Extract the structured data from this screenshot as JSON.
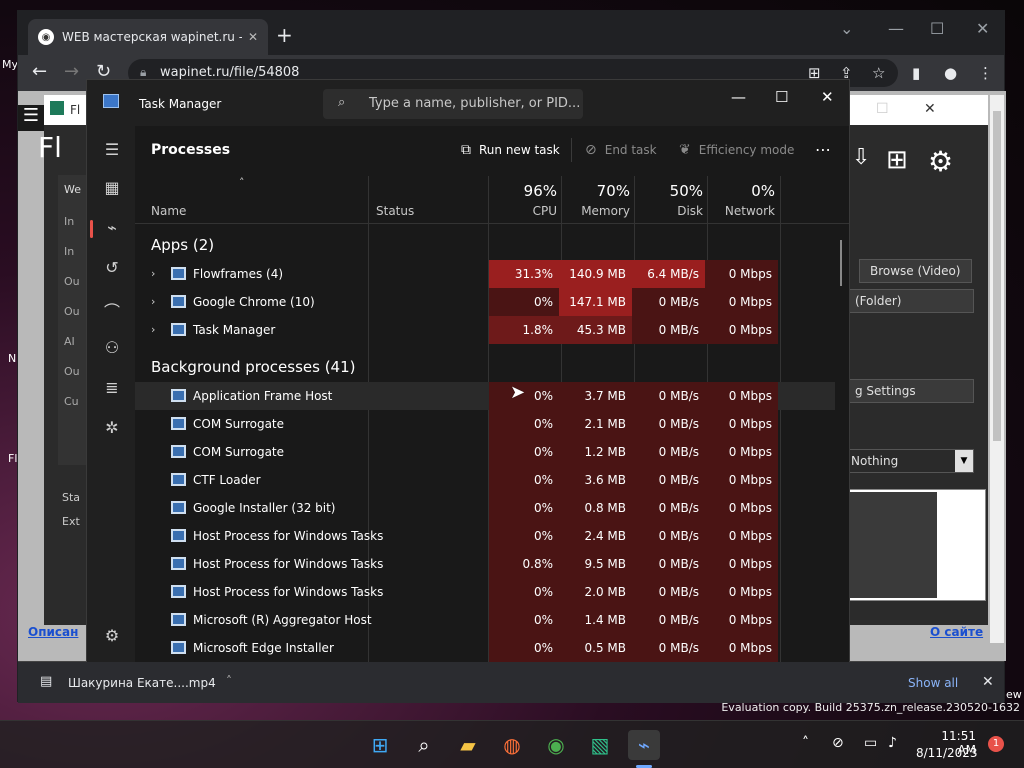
{
  "desktop": {
    "eval_text": "Evaluation copy. Build 25375.zn_release.230520-1632",
    "frag_my": "My",
    "frag_n": "N",
    "frag_fl": "Fl",
    "frag_ew": "ew"
  },
  "chrome": {
    "tab_title": "WEB мастерская wapinet.ru - Ш",
    "url": "wapinet.ru/file/54808",
    "download_file": "Шакурина Екате....mp4",
    "show_all": "Show all",
    "page_links": {
      "left": "Описан",
      "right": "О сайте"
    }
  },
  "flowframes": {
    "title_frag": "Fl",
    "big_title": "Fl",
    "nav_items": [
      "We",
      "In",
      "In",
      "Ou",
      "Ou",
      "AI",
      "Ou",
      "Cu"
    ],
    "status_frag": "Sta",
    "extra_frag": "Ext",
    "browse_video": "Browse (Video)",
    "folder": "(Folder)",
    "settings": "g Settings",
    "dropdown_value": "Nothing"
  },
  "taskmanager": {
    "title": "Task Manager",
    "search_placeholder": "Type a name, publisher, or PID...",
    "page_title": "Processes",
    "run_new_task": "Run new task",
    "end_task": "End task",
    "efficiency_mode": "Efficiency mode",
    "columns": {
      "name": "Name",
      "status": "Status",
      "cpu_pct": "96%",
      "cpu": "CPU",
      "mem_pct": "70%",
      "mem": "Memory",
      "disk_pct": "50%",
      "disk": "Disk",
      "net_pct": "0%",
      "net": "Network"
    },
    "apps_group": "Apps (2)",
    "bg_group": "Background processes (41)",
    "apps": [
      {
        "name": "Flowframes (4)",
        "cpu": "31.3%",
        "mem": "140.9 MB",
        "disk": "6.4 MB/s",
        "net": "0 Mbps"
      },
      {
        "name": "Google Chrome (10)",
        "cpu": "0%",
        "mem": "147.1 MB",
        "disk": "0 MB/s",
        "net": "0 Mbps"
      },
      {
        "name": "Task Manager",
        "cpu": "1.8%",
        "mem": "45.3 MB",
        "disk": "0 MB/s",
        "net": "0 Mbps"
      }
    ],
    "background": [
      {
        "name": "Application Frame Host",
        "cpu": "0%",
        "mem": "3.7 MB",
        "disk": "0 MB/s",
        "net": "0 Mbps"
      },
      {
        "name": "COM Surrogate",
        "cpu": "0%",
        "mem": "2.1 MB",
        "disk": "0 MB/s",
        "net": "0 Mbps"
      },
      {
        "name": "COM Surrogate",
        "cpu": "0%",
        "mem": "1.2 MB",
        "disk": "0 MB/s",
        "net": "0 Mbps"
      },
      {
        "name": "CTF Loader",
        "cpu": "0%",
        "mem": "3.6 MB",
        "disk": "0 MB/s",
        "net": "0 Mbps"
      },
      {
        "name": "Google Installer (32 bit)",
        "cpu": "0%",
        "mem": "0.8 MB",
        "disk": "0 MB/s",
        "net": "0 Mbps"
      },
      {
        "name": "Host Process for Windows Tasks",
        "cpu": "0%",
        "mem": "2.4 MB",
        "disk": "0 MB/s",
        "net": "0 Mbps"
      },
      {
        "name": "Host Process for Windows Tasks",
        "cpu": "0.8%",
        "mem": "9.5 MB",
        "disk": "0 MB/s",
        "net": "0 Mbps"
      },
      {
        "name": "Host Process for Windows Tasks",
        "cpu": "0%",
        "mem": "2.0 MB",
        "disk": "0 MB/s",
        "net": "0 Mbps"
      },
      {
        "name": "Microsoft (R) Aggregator Host",
        "cpu": "0%",
        "mem": "1.4 MB",
        "disk": "0 MB/s",
        "net": "0 Mbps"
      },
      {
        "name": "Microsoft Edge Installer",
        "cpu": "0%",
        "mem": "0.5 MB",
        "disk": "0 MB/s",
        "net": "0 Mbps"
      }
    ]
  },
  "taskbar": {
    "time": "11:51 AM",
    "date": "8/11/2023",
    "notif_count": "1"
  },
  "colors": {
    "heat_high": "#9a1f1f",
    "heat_mid": "#6e1a1a",
    "heat_low": "#4a1414",
    "accent": "#e8524a"
  }
}
